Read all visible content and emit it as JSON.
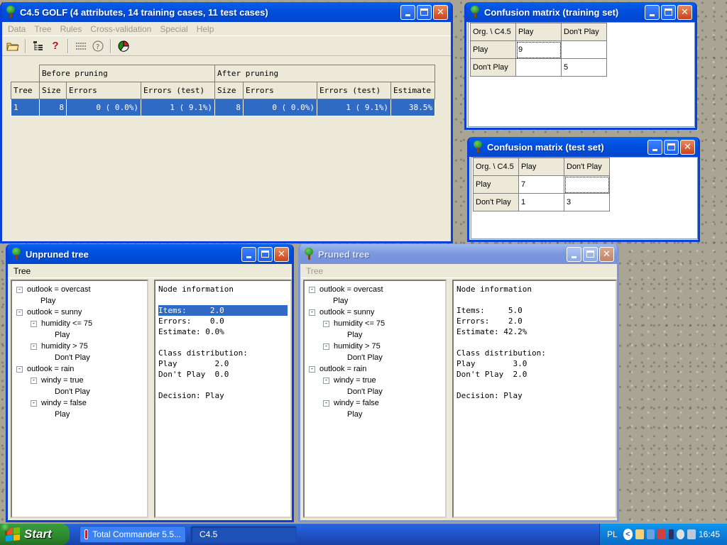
{
  "colors": {
    "titlebar_active": "#0050e0",
    "selection": "#316ac5",
    "window_bg": "#ece9d8",
    "start_green": "#2f8f2f"
  },
  "main": {
    "title": "C4.5 GOLF (4 attributes, 14 training cases, 11 test cases)",
    "menu": [
      "Data",
      "Tree",
      "Rules",
      "Cross-validation",
      "Special",
      "Help"
    ],
    "toolbar_icons": [
      "open-folder-icon",
      "tree-view-icon",
      "help-icon",
      "list-icon",
      "about-icon",
      "pie-chart-icon"
    ],
    "summary": {
      "group_before": "Before pruning",
      "group_after": "After pruning",
      "headers": [
        "Tree",
        "Size",
        "Errors",
        "Errors (test)",
        "Size",
        "Errors",
        "Errors (test)",
        "Estimate"
      ],
      "row": [
        "1",
        "8",
        "0 (  0.0%)",
        "1 (  9.1%)",
        "8",
        "0 (  0.0%)",
        "1 (  9.1%)",
        "38.5%"
      ]
    }
  },
  "cm_train": {
    "title": "Confusion matrix (training set)",
    "header": [
      "Org. \\ C4.5",
      "Play",
      "Don't Play"
    ],
    "rows": [
      [
        "Play",
        "9",
        ""
      ],
      [
        "Don't Play",
        "",
        "5"
      ]
    ]
  },
  "cm_test": {
    "title": "Confusion matrix (test set)",
    "header": [
      "Org. \\ C4.5",
      "Play",
      "Don't Play"
    ],
    "rows": [
      [
        "Play",
        "7",
        ""
      ],
      [
        "Don't Play",
        "1",
        "3"
      ]
    ]
  },
  "unpruned": {
    "title": "Unpruned tree",
    "menu": "Tree",
    "tree": [
      "outlook = overcast",
      "Play",
      "outlook = sunny",
      "humidity <= 75",
      "Play",
      "humidity > 75",
      "Don't Play",
      "outlook = rain",
      "windy = true",
      "Don't Play",
      "windy = false",
      "Play"
    ],
    "info": {
      "heading": "Node information",
      "items": "Items:     2.0",
      "errors": "Errors:    0.0",
      "estimate": "Estimate: 0.0%",
      "class_heading": "Class distribution:",
      "class_play": "Play        2.0",
      "class_dont": "Don't Play  0.0",
      "decision": "Decision: Play"
    }
  },
  "pruned": {
    "title": "Pruned tree",
    "menu": "Tree",
    "tree": [
      "outlook = overcast",
      "Play",
      "outlook = sunny",
      "humidity <= 75",
      "Play",
      "humidity > 75",
      "Don't Play",
      "outlook = rain",
      "windy = true",
      "Don't Play",
      "windy = false",
      "Play"
    ],
    "info": {
      "heading": "Node information",
      "items": "Items:     5.0",
      "errors": "Errors:    2.0",
      "estimate": "Estimate: 42.2%",
      "class_heading": "Class distribution:",
      "class_play": "Play        3.0",
      "class_dont": "Don't Play  2.0",
      "decision": "Decision: Play"
    }
  },
  "taskbar": {
    "start": "Start",
    "tasks": [
      "Total Commander 5.5...",
      "C4.5"
    ],
    "lang": "PL",
    "clock": "16:45"
  }
}
